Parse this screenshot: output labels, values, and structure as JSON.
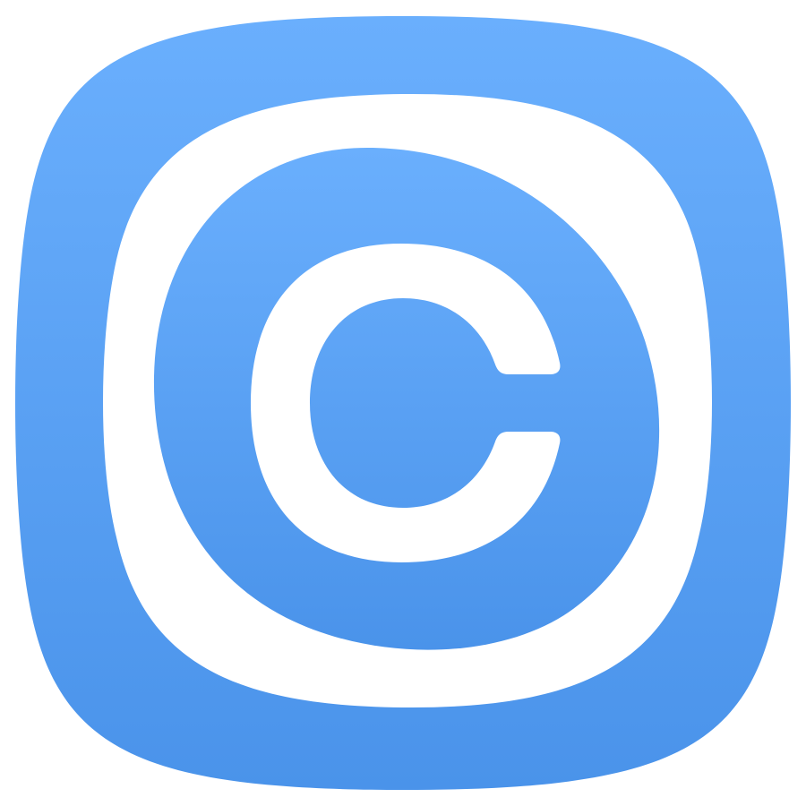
{
  "icon": {
    "name": "copyright-icon",
    "glyph": "C",
    "colors": {
      "gradient_top": "#6aaffd",
      "gradient_bottom": "#4a93ea",
      "foreground": "#ffffff",
      "background": "#ffffff"
    }
  }
}
